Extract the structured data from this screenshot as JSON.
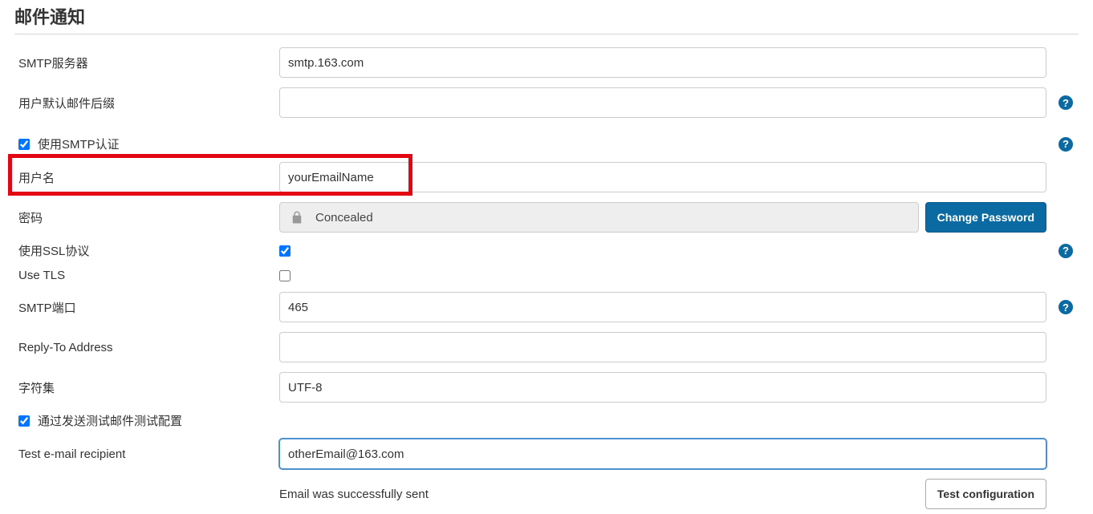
{
  "section": {
    "title": "邮件通知"
  },
  "labels": {
    "smtp_server": "SMTP服务器",
    "default_suffix": "用户默认邮件后缀",
    "use_smtp_auth": "使用SMTP认证",
    "username": "用户名",
    "password": "密码",
    "use_ssl": "使用SSL协议",
    "use_tls": "Use TLS",
    "smtp_port": "SMTP端口",
    "reply_to": "Reply-To Address",
    "charset": "字符集",
    "test_by_send": "通过发送测试邮件测试配置",
    "test_recipient": "Test e-mail recipient"
  },
  "values": {
    "smtp_server": "smtp.163.com",
    "default_suffix": "",
    "username": "yourEmailName",
    "password_concealed": "Concealed",
    "smtp_port": "465",
    "reply_to": "",
    "charset": "UTF-8",
    "test_recipient": "otherEmail@163.com"
  },
  "buttons": {
    "change_password": "Change Password",
    "test_configuration": "Test configuration"
  },
  "status": {
    "test_result": "Email was successfully sent"
  },
  "help_glyph": "?"
}
